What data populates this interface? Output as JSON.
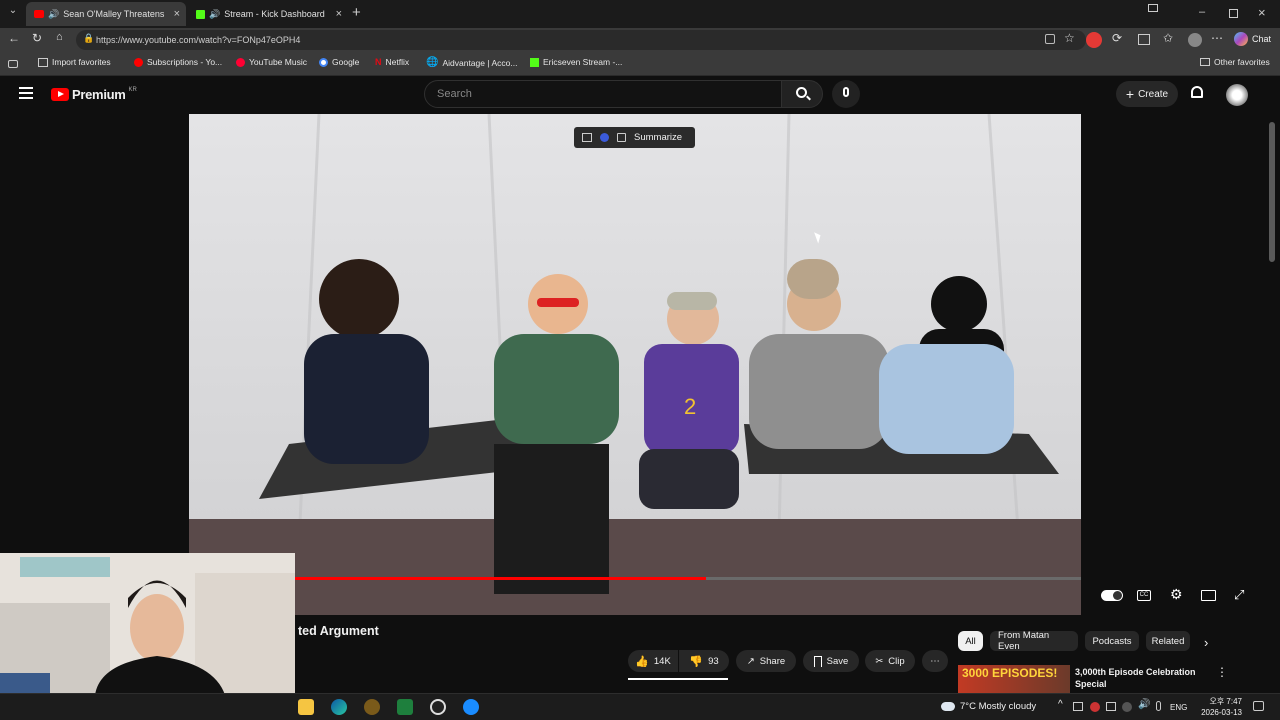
{
  "browser": {
    "tabs": [
      {
        "title": "Sean O'Malley Threatens Mat",
        "active": true
      },
      {
        "title": "Stream - Kick Dashboard",
        "active": false
      }
    ],
    "url": "https://www.youtube.com/watch?v=FONp47eOPH4",
    "chat_label": "Chat",
    "bookmarks": [
      "Import favorites",
      "Subscriptions - Yo...",
      "YouTube Music",
      "Google",
      "Netflix",
      "Aidvantage | Acco...",
      "Ericseven Stream -..."
    ],
    "other_favorites": "Other favorites"
  },
  "youtube": {
    "logo_text": "Premium",
    "region": "KR",
    "search_placeholder": "Search",
    "create_label": "Create"
  },
  "player": {
    "summarize_label": "Summarize",
    "progress": 0.58
  },
  "video": {
    "title_visible": "ted Argument",
    "likes": "14K",
    "dislikes": "93",
    "share_label": "Share",
    "save_label": "Save",
    "clip_label": "Clip"
  },
  "chips": [
    "All",
    "From Matan Even",
    "Podcasts",
    "Related"
  ],
  "recommendation": {
    "thumb_text": "3000 EPISODES!",
    "title": "3,000th Episode Celebration Special"
  },
  "taskbar": {
    "weather": "7°C  Mostly cloudy",
    "lang": "ENG",
    "ampm": "오후",
    "time": "7:47",
    "date": "2026-03-13"
  },
  "colors": {
    "yt_red": "#ff0000",
    "kick_green": "#53fc18",
    "bg": "#0f0f0f"
  }
}
